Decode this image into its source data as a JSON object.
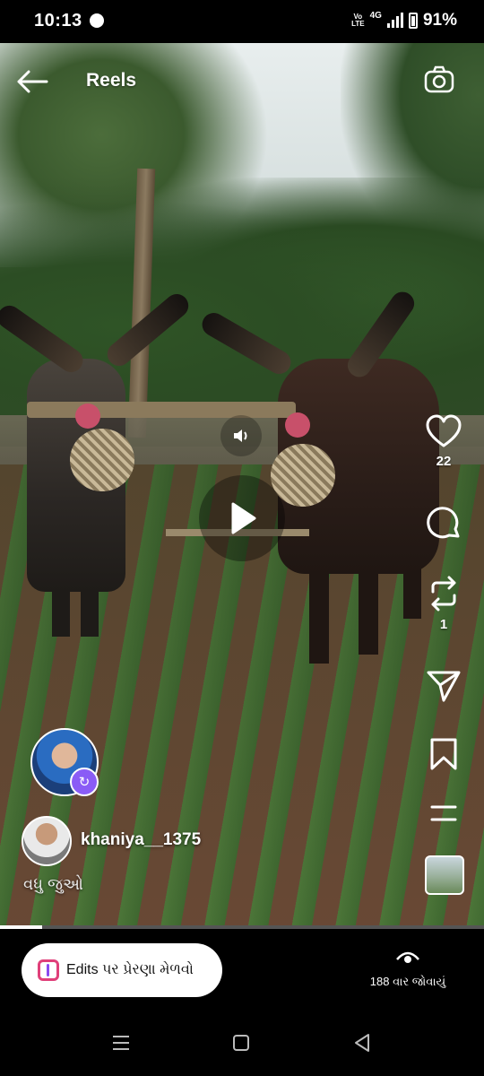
{
  "status_bar": {
    "time": "10:13",
    "network_label": "4G",
    "volte_label": "Vo\nLTE",
    "battery_percent": "91%"
  },
  "header": {
    "title": "Reels",
    "back_icon": "arrow-left-icon",
    "camera_icon": "camera-icon"
  },
  "player": {
    "mute_icon": "speaker-icon",
    "play_icon": "play-icon"
  },
  "actions": {
    "like_count": "22",
    "repost_count": "1",
    "like_icon": "heart-icon",
    "comment_icon": "comment-icon",
    "repost_icon": "repost-icon",
    "share_icon": "send-icon",
    "save_icon": "bookmark-icon",
    "more_icon": "more-lines-icon"
  },
  "post": {
    "username": "khaniya__1375",
    "see_more": "વધુ જુઓ",
    "progress": 0.087
  },
  "bottom": {
    "edits_label": "Edits પર પ્રેરણા મેળવો",
    "views_label": "188 વાર જોવાયું"
  },
  "colors": {
    "accent_pink": "#e0407a",
    "accent_purple": "#8a4af0",
    "remix_badge": "#8a5cf6"
  }
}
